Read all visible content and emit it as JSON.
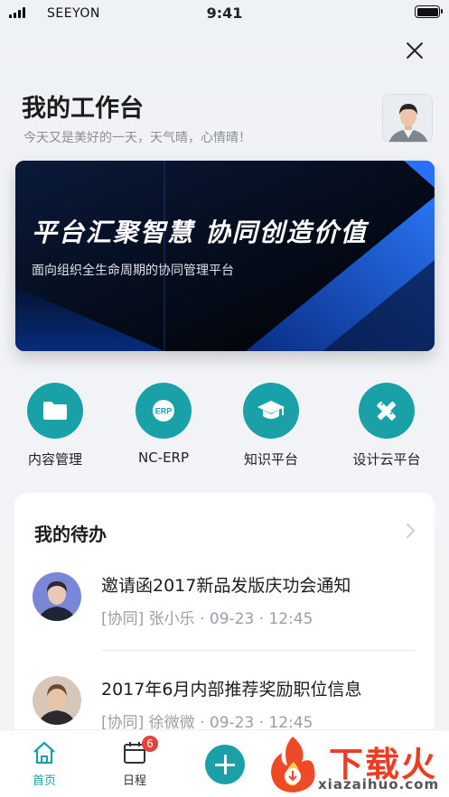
{
  "status_bar": {
    "carrier": "SEEYON",
    "time": "9:41"
  },
  "header": {
    "title": "我的工作台",
    "subtitle": "今天又是美好的一天，天气晴，心情晴！"
  },
  "banner": {
    "title": "平台汇聚智慧 协同创造价值",
    "subtitle": "面向组织全生命周期的协同管理平台"
  },
  "apps": [
    {
      "label": "内容管理",
      "icon": "folder-icon"
    },
    {
      "label": "NC-ERP",
      "icon": "erp-icon",
      "icon_text": "ERP"
    },
    {
      "label": "知识平台",
      "icon": "graduation-cap-icon"
    },
    {
      "label": "设计云平台",
      "icon": "pencil-ruler-icon"
    }
  ],
  "todo": {
    "title": "我的待办",
    "items": [
      {
        "title": "邀请函2017新品发版庆功会通知",
        "meta": "[协同] 张小乐 · 09-23 · 12:45"
      },
      {
        "title": "2017年6月内部推荐奖励职位信息",
        "meta": "[协同] 徐微微 · 09-23 · 12:45"
      }
    ]
  },
  "tab_bar": {
    "home_label": "首页",
    "schedule_label": "日程",
    "schedule_badge": "6"
  },
  "watermark": {
    "text": "下载火",
    "url": "xiazaihuo.com"
  },
  "colors": {
    "accent": "#1aa1a8",
    "badge": "#e5423d",
    "watermark": "#ee3b24"
  }
}
